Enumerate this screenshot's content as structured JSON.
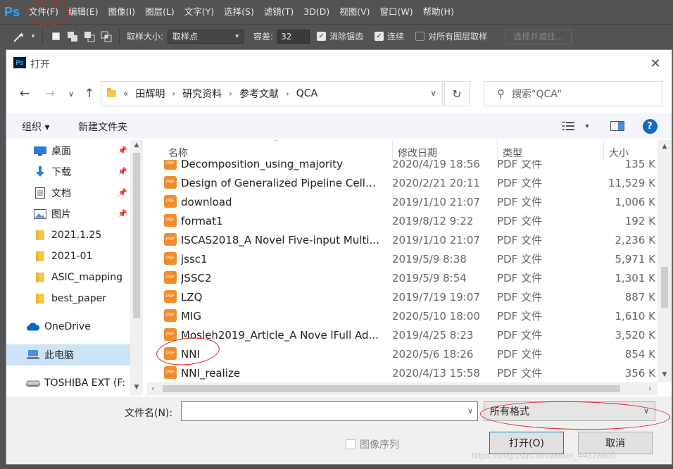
{
  "ps": {
    "logo": "Ps",
    "menu": [
      "文件(F)",
      "编辑(E)",
      "图像(I)",
      "图层(L)",
      "文字(Y)",
      "选择(S)",
      "滤镜(T)",
      "3D(D)",
      "视图(V)",
      "窗口(W)",
      "帮助(H)"
    ],
    "toolbar": {
      "sample_size_label": "取样大小:",
      "sample_size_value": "取样点",
      "tolerance_label": "容差:",
      "tolerance_value": "32",
      "antialias_label": "消除锯齿",
      "contiguous_label": "连续",
      "all_layers_label": "对所有图层取样",
      "select_mask_label": "选择并遮住..."
    }
  },
  "dialog": {
    "title": "打开",
    "breadcrumb": [
      "«",
      "田辉明",
      "研究资料",
      "参考文献",
      "QCA"
    ],
    "search_placeholder": "搜索\"QCA\"",
    "commands": {
      "organize": "组织 ▾",
      "new_folder": "新建文件夹"
    },
    "nav_items": [
      {
        "label": "桌面",
        "icon": "desktop-icon",
        "pinned": true
      },
      {
        "label": "下载",
        "icon": "download-icon",
        "pinned": true
      },
      {
        "label": "文档",
        "icon": "document-icon",
        "pinned": true
      },
      {
        "label": "图片",
        "icon": "picture-icon",
        "pinned": true
      },
      {
        "label": "2021.1.25",
        "icon": "folder-icon",
        "pinned": false
      },
      {
        "label": "2021-01",
        "icon": "folder-icon",
        "pinned": false
      },
      {
        "label": "ASIC_mapping",
        "icon": "folder-icon",
        "pinned": false
      },
      {
        "label": "best_paper",
        "icon": "folder-icon",
        "pinned": false
      },
      {
        "label": "OneDrive",
        "icon": "cloud-icon",
        "pinned": false
      },
      {
        "label": "此电脑",
        "icon": "computer-icon",
        "pinned": false,
        "selected": true
      },
      {
        "label": "TOSHIBA EXT (F:",
        "icon": "drive-icon",
        "pinned": false
      }
    ],
    "columns": {
      "name": "名称",
      "date": "修改日期",
      "type": "类型",
      "size": "大小"
    },
    "files": [
      {
        "name": "Decomposition_using_majority",
        "date": "2020/4/19 18:56",
        "type": "PDF 文件",
        "size": "135 K"
      },
      {
        "name": "Design of Generalized Pipeline Cellul...",
        "date": "2020/2/21 20:11",
        "type": "PDF 文件",
        "size": "11,529 K"
      },
      {
        "name": "download",
        "date": "2019/1/10 21:07",
        "type": "PDF 文件",
        "size": "1,006 K"
      },
      {
        "name": "format1",
        "date": "2019/8/12 9:22",
        "type": "PDF 文件",
        "size": "192 K"
      },
      {
        "name": "ISCAS2018_A Novel Five-input Multi...",
        "date": "2019/1/10 21:07",
        "type": "PDF 文件",
        "size": "2,236 K"
      },
      {
        "name": "jssc1",
        "date": "2019/5/9 8:38",
        "type": "PDF 文件",
        "size": "5,971 K"
      },
      {
        "name": "JSSC2",
        "date": "2019/5/9 8:54",
        "type": "PDF 文件",
        "size": "1,301 K"
      },
      {
        "name": "LZQ",
        "date": "2019/7/19 19:07",
        "type": "PDF 文件",
        "size": "887 K"
      },
      {
        "name": "MIG",
        "date": "2020/5/10 18:00",
        "type": "PDF 文件",
        "size": "1,610 K"
      },
      {
        "name": "Mosleh2019_Article_A Nove lFull Ad...",
        "date": "2019/4/25 8:23",
        "type": "PDF 文件",
        "size": "3,520 K"
      },
      {
        "name": "NNI",
        "date": "2020/5/6 18:26",
        "type": "PDF 文件",
        "size": "854 K"
      },
      {
        "name": "NNI_realize",
        "date": "2020/4/13 15:58",
        "type": "PDF 文件",
        "size": "356 K"
      }
    ],
    "filename_label": "文件名(N):",
    "filename_value": "",
    "filter_value": "所有格式",
    "image_sequence_label": "图像序列",
    "open_label": "打开(O)",
    "cancel_label": "取消"
  },
  "watermark": "https://blog.csdn.net/weixin_44378800"
}
